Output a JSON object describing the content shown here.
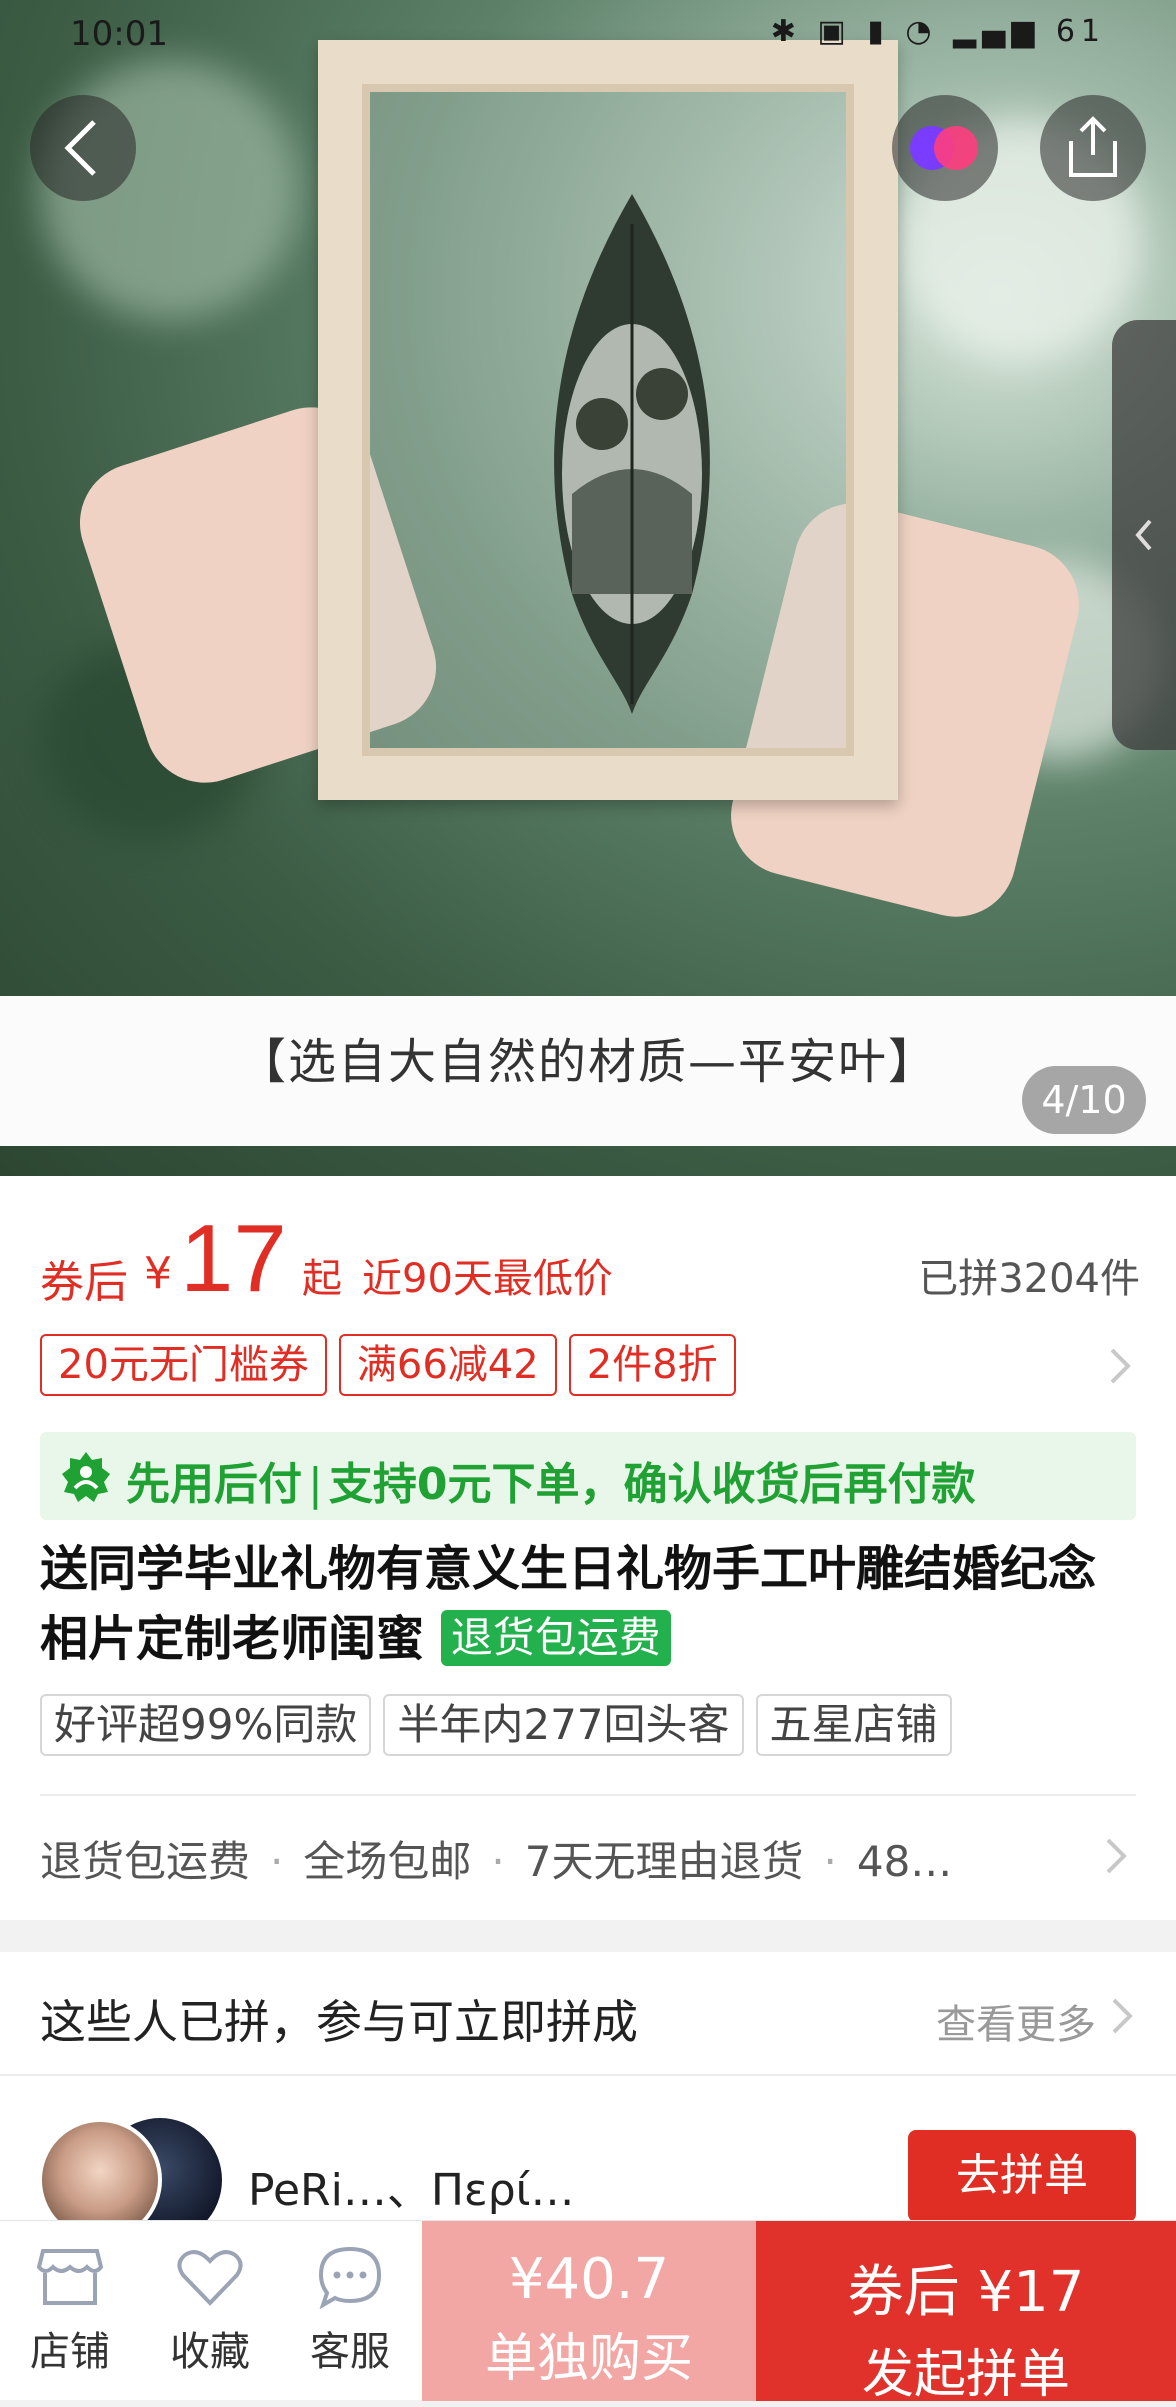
{
  "status_bar": {
    "time": "10:01",
    "battery": "61"
  },
  "hero": {
    "caption": "【选自大自然的材质—平安叶】",
    "counter": "4/10"
  },
  "price": {
    "prefix": "券后",
    "currency": "¥",
    "amount": "17",
    "suffix": "起",
    "lowest_label": "近90天最低价",
    "sold": "已拼3204件"
  },
  "promo_tags": [
    "20元无门槛券",
    "满66减42",
    "2件8折"
  ],
  "bnpl": {
    "label": "先用后付",
    "detail": "支持0元下单，确认收货后再付款"
  },
  "product": {
    "title": "送同学毕业礼物有意义生日礼物手工叶雕结婚纪念相片定制老师闺蜜",
    "title_tag": "退货包运费"
  },
  "badges": [
    "好评超99%同款",
    "半年内277回头客",
    "五星店铺"
  ],
  "services": [
    "退货包运费",
    "全场包邮",
    "7天无理由退货",
    "48…"
  ],
  "group": {
    "title": "这些人已拼，参与可立即拼成",
    "see_more": "查看更多",
    "buyers": "PeRi…、Περί…",
    "join_label": "去拼单"
  },
  "bottom_bar": {
    "store": "店铺",
    "favorite": "收藏",
    "service": "客服",
    "solo_price": "¥40.7",
    "solo_label": "单独购买",
    "group_price": "券后 ¥17",
    "group_label": "发起拼单"
  },
  "colors": {
    "accent": "#e02e24",
    "green": "#20a133",
    "solo_bg": "#f2a7a4"
  }
}
